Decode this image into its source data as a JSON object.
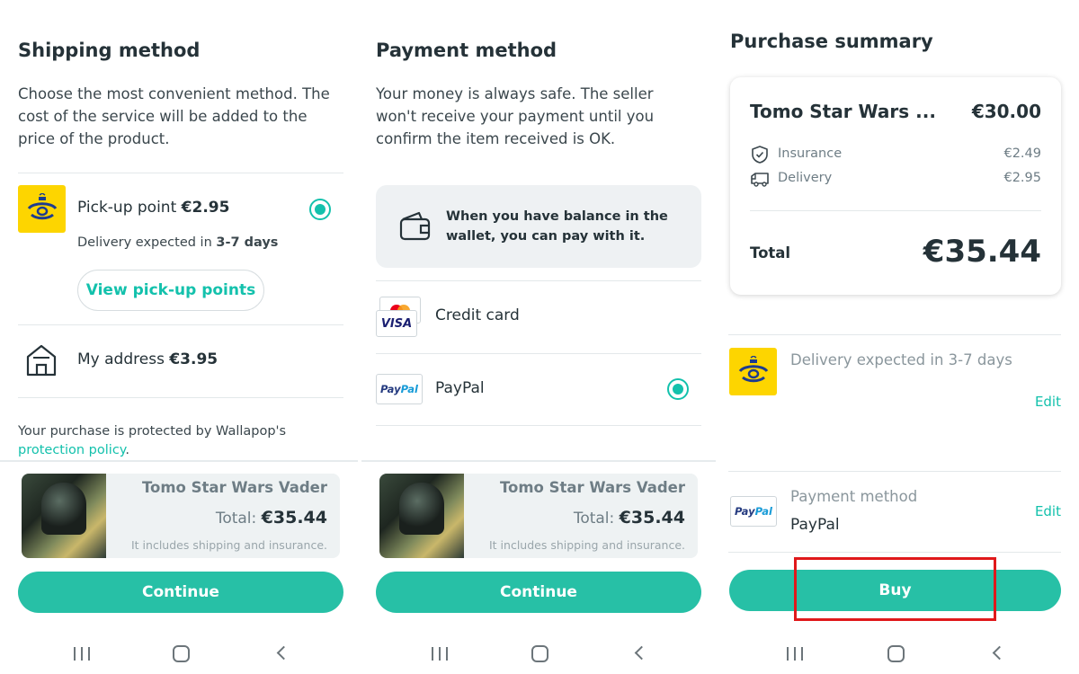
{
  "colors": {
    "accent": "#13c1ac",
    "button": "#27c0a6",
    "highlight": "#e0191b",
    "correos": "#fdd500"
  },
  "shipping": {
    "title": "Shipping method",
    "description": "Choose the most convenient method. The cost of the service will be added to the price of the product.",
    "pickup": {
      "label": "Pick-up point",
      "price": "€2.95",
      "delivery_prefix": "Delivery expected in",
      "delivery_days": "3-7 days",
      "view_button": "View pick-up points",
      "selected": true,
      "icon": "correos-logo"
    },
    "address": {
      "label": "My address",
      "price": "€3.95",
      "icon": "house-icon"
    },
    "protection_text": "Your purchase is protected by Wallapop's",
    "protection_link": "protection policy",
    "protection_end": "."
  },
  "payment": {
    "title": "Payment method",
    "description": "Your money is always safe. The seller won't receive your payment until you confirm the item received is OK.",
    "wallet_note": "When you have balance in the wallet, you can pay with it.",
    "wallet_icon": "wallet-icon",
    "credit_card": {
      "label": "Credit card",
      "card_brand": "VISA"
    },
    "paypal": {
      "label": "PayPal",
      "logo_part1": "Pay",
      "logo_part2": "Pal",
      "selected": true
    }
  },
  "product": {
    "title": "Tomo Star Wars Vader",
    "total_label": "Total:",
    "total_value": "€35.44",
    "note": "It includes shipping and insurance."
  },
  "buttons": {
    "continue": "Continue",
    "buy": "Buy"
  },
  "summary": {
    "title": "Purchase summary",
    "item_name": "Tomo Star Wars ...",
    "item_price": "€30.00",
    "insurance_label": "Insurance",
    "insurance_price": "€2.49",
    "delivery_label": "Delivery",
    "delivery_price": "€2.95",
    "total_label": "Total",
    "total_value": "€35.44",
    "delivery_expected": "Delivery expected in 3-7 days",
    "edit": "Edit",
    "payment_method_label": "Payment method",
    "payment_method_value": "PayPal"
  }
}
